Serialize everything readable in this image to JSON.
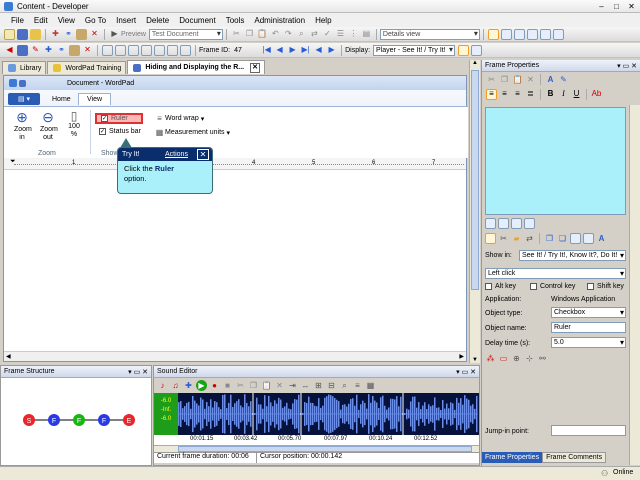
{
  "window": {
    "title": "Content - Developer"
  },
  "menu": [
    "File",
    "Edit",
    "View",
    "Go To",
    "Insert",
    "Delete",
    "Document",
    "Tools",
    "Administration",
    "Help"
  ],
  "toolbar1": {
    "preview_label": "Preview",
    "document_combo": "Test Document",
    "view_combo": "Details view"
  },
  "toolbar2": {
    "frame_id_label": "Frame ID:",
    "frame_id_value": "47",
    "display_label": "Display:",
    "display_value": "Player - See It! / Try It!"
  },
  "doc_tabs": [
    {
      "label": "Library"
    },
    {
      "label": "WordPad Training"
    },
    {
      "label": "Hiding and Displaying the R..."
    }
  ],
  "wordpad": {
    "title": "Document - WordPad",
    "tabs": [
      "Home",
      "View"
    ],
    "zoom_in": "Zoom in",
    "zoom_out": "Zoom out",
    "zoom_100": "100 %",
    "zoom_group": "Zoom",
    "show_group": "Show",
    "ruler": "Ruler",
    "statusbar": "Status bar",
    "word_wrap": "Word wrap",
    "measurement_units": "Measurement units",
    "ruler_numbers": [
      "1",
      "2",
      "3",
      "4",
      "5",
      "6",
      "7"
    ]
  },
  "callout": {
    "header": "Try It!",
    "actions": "Actions",
    "text_before": "Click the",
    "bold": "Ruler",
    "text_after": "option."
  },
  "frame_structure": {
    "title": "Frame Structure",
    "nodes": [
      {
        "label": "S",
        "color": "#e8262b"
      },
      {
        "label": "F",
        "color": "#2a39e6"
      },
      {
        "label": "F",
        "color": "#17b614"
      },
      {
        "label": "F",
        "color": "#2a39e6"
      },
      {
        "label": "E",
        "color": "#e8262b"
      }
    ]
  },
  "sound_editor": {
    "title": "Sound Editor",
    "db_labels": [
      "-6.0",
      "-Inf.",
      "-6.0"
    ],
    "times": [
      "00:01.15",
      "00:03.42",
      "00:05.70",
      "00:07.97",
      "00:10.24",
      "00:12.52"
    ],
    "frame_duration": "Current frame duration: 00:06",
    "cursor_position": "Cursor position: 00:00.142"
  },
  "frame_properties": {
    "title": "Frame Properties",
    "show_in_label": "Show in:",
    "show_in_value": "See It! / Try It!, Know It?, Do It!",
    "action": "Left click",
    "alt_key": "Alt key",
    "control_key": "Control key",
    "shift_key": "Shift key",
    "application_label": "Application:",
    "application_value": "Windows Application",
    "object_type_label": "Object type:",
    "object_type_value": "Checkbox",
    "object_name_label": "Object name:",
    "object_name_value": "Ruler",
    "delay_label": "Delay time (s):",
    "delay_value": "5.0",
    "jump_in_label": "Jump-in point:",
    "bottom_tabs": [
      "Frame Properties",
      "Frame Comments"
    ]
  },
  "status": {
    "online": "Online"
  }
}
